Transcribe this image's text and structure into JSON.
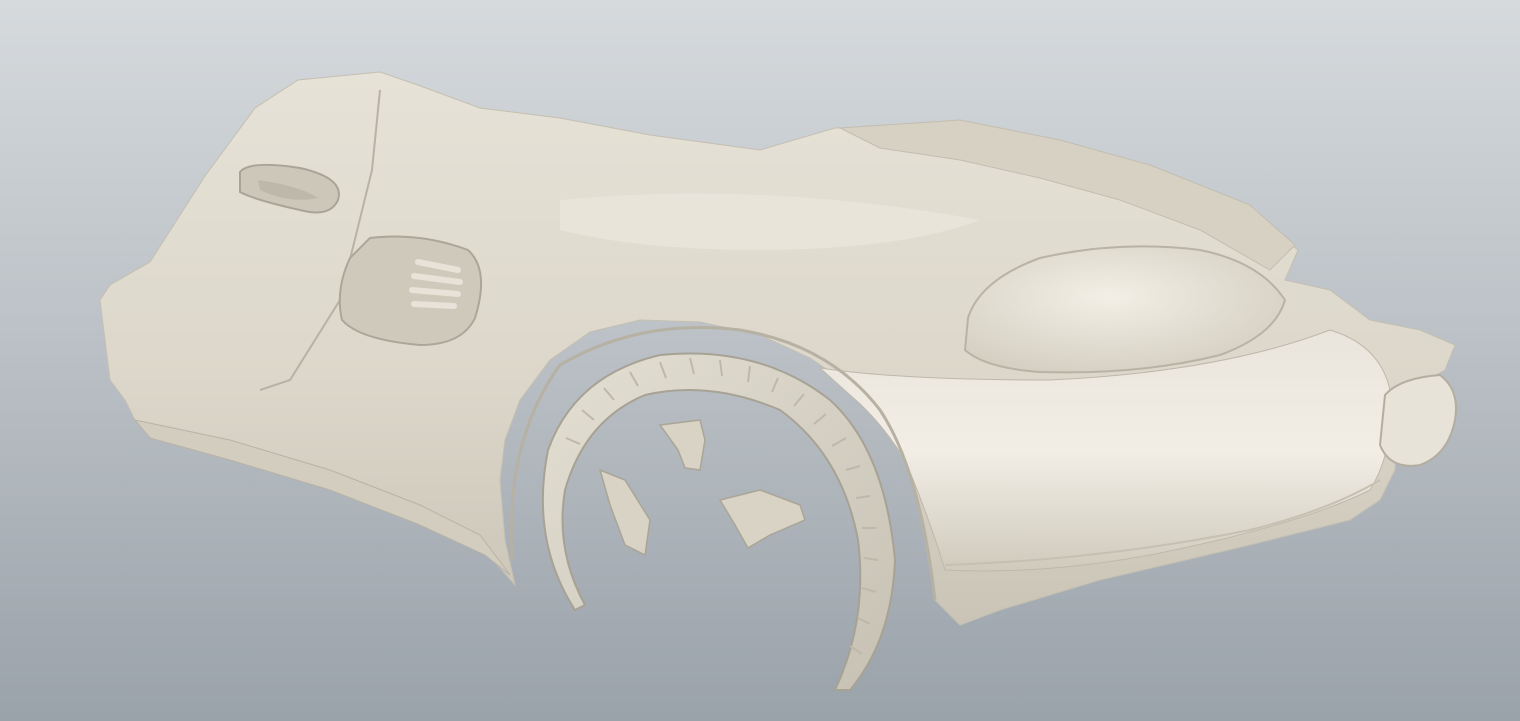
{
  "viewport": {
    "background_top": "#d6dadd",
    "background_bottom": "#9aa2aa"
  },
  "model": {
    "surface_color": "#ddd8cb",
    "shadow_color": "#b9b4a6",
    "highlight_color": "#f1ede4"
  }
}
